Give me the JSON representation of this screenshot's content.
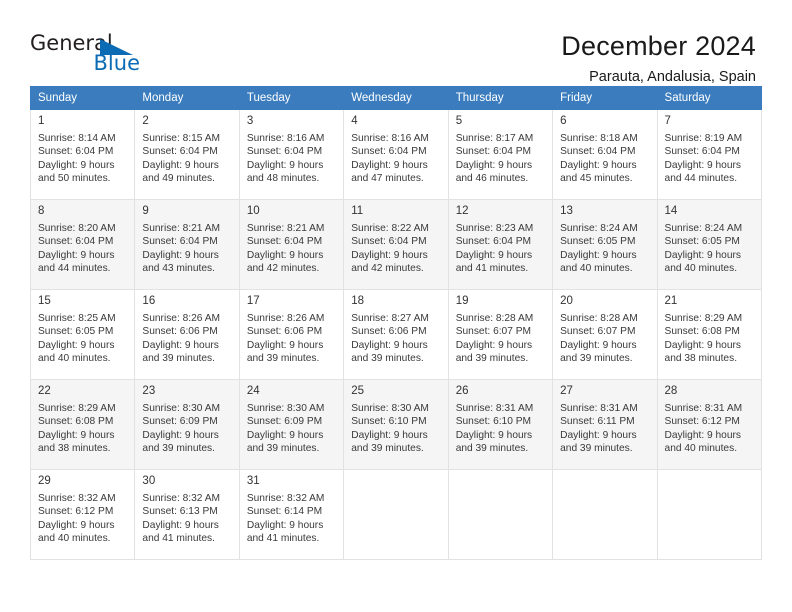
{
  "brand": {
    "name_part1": "General",
    "name_part2": "Blue",
    "accent_color": "#0b6cb5"
  },
  "header": {
    "title": "December 2024",
    "subtitle": "Parauta, Andalusia, Spain"
  },
  "calendar": {
    "header_bg": "#3a7cbe",
    "weekdays": [
      "Sunday",
      "Monday",
      "Tuesday",
      "Wednesday",
      "Thursday",
      "Friday",
      "Saturday"
    ],
    "weeks": [
      {
        "shaded": false,
        "days": [
          {
            "num": "1",
            "detail": "Sunrise: 8:14 AM\nSunset: 6:04 PM\nDaylight: 9 hours\nand 50 minutes."
          },
          {
            "num": "2",
            "detail": "Sunrise: 8:15 AM\nSunset: 6:04 PM\nDaylight: 9 hours\nand 49 minutes."
          },
          {
            "num": "3",
            "detail": "Sunrise: 8:16 AM\nSunset: 6:04 PM\nDaylight: 9 hours\nand 48 minutes."
          },
          {
            "num": "4",
            "detail": "Sunrise: 8:16 AM\nSunset: 6:04 PM\nDaylight: 9 hours\nand 47 minutes."
          },
          {
            "num": "5",
            "detail": "Sunrise: 8:17 AM\nSunset: 6:04 PM\nDaylight: 9 hours\nand 46 minutes."
          },
          {
            "num": "6",
            "detail": "Sunrise: 8:18 AM\nSunset: 6:04 PM\nDaylight: 9 hours\nand 45 minutes."
          },
          {
            "num": "7",
            "detail": "Sunrise: 8:19 AM\nSunset: 6:04 PM\nDaylight: 9 hours\nand 44 minutes."
          }
        ]
      },
      {
        "shaded": true,
        "days": [
          {
            "num": "8",
            "detail": "Sunrise: 8:20 AM\nSunset: 6:04 PM\nDaylight: 9 hours\nand 44 minutes."
          },
          {
            "num": "9",
            "detail": "Sunrise: 8:21 AM\nSunset: 6:04 PM\nDaylight: 9 hours\nand 43 minutes."
          },
          {
            "num": "10",
            "detail": "Sunrise: 8:21 AM\nSunset: 6:04 PM\nDaylight: 9 hours\nand 42 minutes."
          },
          {
            "num": "11",
            "detail": "Sunrise: 8:22 AM\nSunset: 6:04 PM\nDaylight: 9 hours\nand 42 minutes."
          },
          {
            "num": "12",
            "detail": "Sunrise: 8:23 AM\nSunset: 6:04 PM\nDaylight: 9 hours\nand 41 minutes."
          },
          {
            "num": "13",
            "detail": "Sunrise: 8:24 AM\nSunset: 6:05 PM\nDaylight: 9 hours\nand 40 minutes."
          },
          {
            "num": "14",
            "detail": "Sunrise: 8:24 AM\nSunset: 6:05 PM\nDaylight: 9 hours\nand 40 minutes."
          }
        ]
      },
      {
        "shaded": false,
        "days": [
          {
            "num": "15",
            "detail": "Sunrise: 8:25 AM\nSunset: 6:05 PM\nDaylight: 9 hours\nand 40 minutes."
          },
          {
            "num": "16",
            "detail": "Sunrise: 8:26 AM\nSunset: 6:06 PM\nDaylight: 9 hours\nand 39 minutes."
          },
          {
            "num": "17",
            "detail": "Sunrise: 8:26 AM\nSunset: 6:06 PM\nDaylight: 9 hours\nand 39 minutes."
          },
          {
            "num": "18",
            "detail": "Sunrise: 8:27 AM\nSunset: 6:06 PM\nDaylight: 9 hours\nand 39 minutes."
          },
          {
            "num": "19",
            "detail": "Sunrise: 8:28 AM\nSunset: 6:07 PM\nDaylight: 9 hours\nand 39 minutes."
          },
          {
            "num": "20",
            "detail": "Sunrise: 8:28 AM\nSunset: 6:07 PM\nDaylight: 9 hours\nand 39 minutes."
          },
          {
            "num": "21",
            "detail": "Sunrise: 8:29 AM\nSunset: 6:08 PM\nDaylight: 9 hours\nand 38 minutes."
          }
        ]
      },
      {
        "shaded": true,
        "days": [
          {
            "num": "22",
            "detail": "Sunrise: 8:29 AM\nSunset: 6:08 PM\nDaylight: 9 hours\nand 38 minutes."
          },
          {
            "num": "23",
            "detail": "Sunrise: 8:30 AM\nSunset: 6:09 PM\nDaylight: 9 hours\nand 39 minutes."
          },
          {
            "num": "24",
            "detail": "Sunrise: 8:30 AM\nSunset: 6:09 PM\nDaylight: 9 hours\nand 39 minutes."
          },
          {
            "num": "25",
            "detail": "Sunrise: 8:30 AM\nSunset: 6:10 PM\nDaylight: 9 hours\nand 39 minutes."
          },
          {
            "num": "26",
            "detail": "Sunrise: 8:31 AM\nSunset: 6:10 PM\nDaylight: 9 hours\nand 39 minutes."
          },
          {
            "num": "27",
            "detail": "Sunrise: 8:31 AM\nSunset: 6:11 PM\nDaylight: 9 hours\nand 39 minutes."
          },
          {
            "num": "28",
            "detail": "Sunrise: 8:31 AM\nSunset: 6:12 PM\nDaylight: 9 hours\nand 40 minutes."
          }
        ]
      },
      {
        "shaded": false,
        "days": [
          {
            "num": "29",
            "detail": "Sunrise: 8:32 AM\nSunset: 6:12 PM\nDaylight: 9 hours\nand 40 minutes."
          },
          {
            "num": "30",
            "detail": "Sunrise: 8:32 AM\nSunset: 6:13 PM\nDaylight: 9 hours\nand 41 minutes."
          },
          {
            "num": "31",
            "detail": "Sunrise: 8:32 AM\nSunset: 6:14 PM\nDaylight: 9 hours\nand 41 minutes."
          },
          {
            "num": "",
            "detail": ""
          },
          {
            "num": "",
            "detail": ""
          },
          {
            "num": "",
            "detail": ""
          },
          {
            "num": "",
            "detail": ""
          }
        ]
      }
    ]
  }
}
